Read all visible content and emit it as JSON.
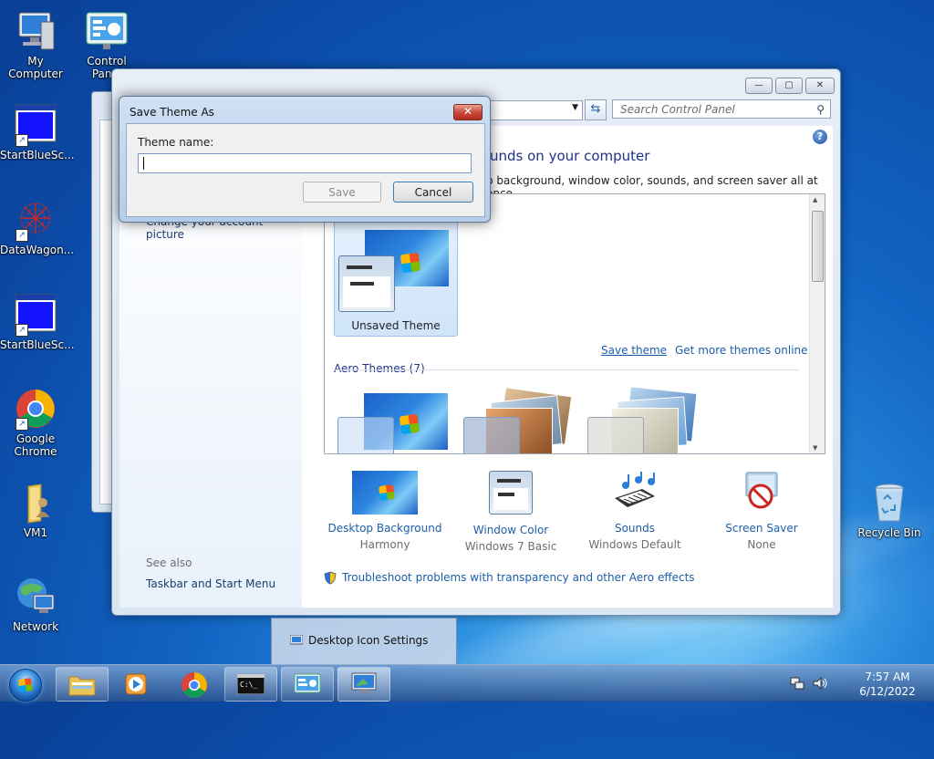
{
  "desktop": {
    "icons": [
      {
        "label": "My Computer",
        "icon": "computer-icon"
      },
      {
        "label": "Control Panel",
        "icon": "control-panel-icon"
      },
      {
        "label": "StartBlueSc...",
        "icon": "blue-screen-shortcut-icon"
      },
      {
        "label": "DataWagon...",
        "icon": "datawagon-icon"
      },
      {
        "label": "StartBlueSc...",
        "icon": "blue-screen-shortcut-icon"
      },
      {
        "label": "Google Chrome",
        "icon": "chrome-icon"
      },
      {
        "label": "VM1",
        "icon": "folder-user-icon"
      },
      {
        "label": "Network",
        "icon": "network-icon"
      },
      {
        "label": "Recycle Bin",
        "icon": "recycle-bin-icon"
      }
    ]
  },
  "control_panel": {
    "search_placeholder": "Search Control Panel",
    "heading": "unds on your computer",
    "description": "p background, window color, sounds, and screen saver all at once.",
    "left_link": "Change your account picture",
    "see_also": "See also",
    "taskbar_link": "Taskbar and Start Menu",
    "current_theme_label": "Unsaved Theme",
    "save_theme": "Save theme",
    "get_more": "Get more themes online",
    "aero_header": "Aero Themes (7)",
    "bottom": [
      {
        "label": "Desktop Background",
        "sub": "Harmony"
      },
      {
        "label": "Window Color",
        "sub": "Windows 7 Basic"
      },
      {
        "label": "Sounds",
        "sub": "Windows Default"
      },
      {
        "label": "Screen Saver",
        "sub": "None"
      }
    ],
    "troubleshoot": "Troubleshoot problems with transparency and other Aero effects"
  },
  "dialog": {
    "title": "Save Theme As",
    "field_label": "Theme name:",
    "field_value": "",
    "save": "Save",
    "cancel": "Cancel",
    "close": "✕"
  },
  "tooltip": {
    "label": "Desktop Icon Settings"
  },
  "taskbar": {
    "time": "7:57 AM",
    "date": "6/12/2022"
  }
}
